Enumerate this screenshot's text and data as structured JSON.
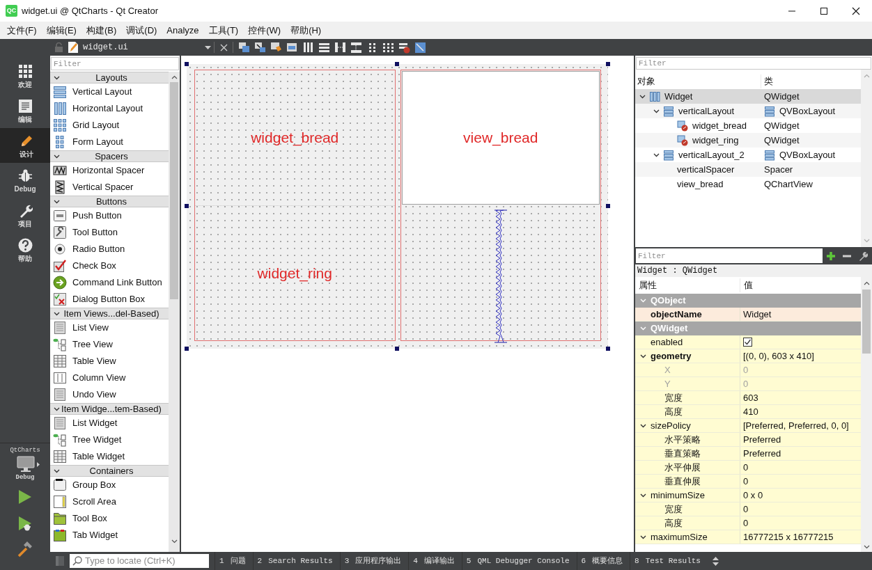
{
  "window": {
    "logo": "QC",
    "title": "widget.ui @ QtCharts - Qt Creator"
  },
  "menu": [
    "文件(F)",
    "编辑(E)",
    "构建(B)",
    "调试(D)",
    "Analyze",
    "工具(T)",
    "控件(W)",
    "帮助(H)"
  ],
  "mode_bar": {
    "items": [
      {
        "label": "欢迎",
        "selected": false
      },
      {
        "label": "编辑",
        "selected": false
      },
      {
        "label": "设计",
        "selected": true
      },
      {
        "label": "Debug",
        "selected": false
      },
      {
        "label": "项目",
        "selected": false
      },
      {
        "label": "帮助",
        "selected": false
      }
    ],
    "kit": {
      "project": "QtCharts",
      "config": "Debug"
    }
  },
  "toolbar": {
    "file": "widget.ui"
  },
  "widget_box": {
    "filter_placeholder": "Filter",
    "categories": [
      {
        "title": "Layouts",
        "expanded": true,
        "items": [
          "Vertical Layout",
          "Horizontal Layout",
          "Grid Layout",
          "Form Layout"
        ]
      },
      {
        "title": "Spacers",
        "expanded": true,
        "items": [
          "Horizontal Spacer",
          "Vertical Spacer"
        ]
      },
      {
        "title": "Buttons",
        "expanded": true,
        "items": [
          "Push Button",
          "Tool Button",
          "Radio Button",
          "Check Box",
          "Command Link Button",
          "Dialog Button Box"
        ]
      },
      {
        "title": "Item Views...del-Based)",
        "expanded": true,
        "items": [
          "List View",
          "Tree View",
          "Table View",
          "Column View",
          "Undo View"
        ]
      },
      {
        "title": "Item Widge...tem-Based)",
        "expanded": true,
        "items": [
          "List Widget",
          "Tree Widget",
          "Table Widget"
        ]
      },
      {
        "title": "Containers",
        "expanded": true,
        "items": [
          "Group Box",
          "Scroll Area",
          "Tool Box",
          "Tab Widget"
        ]
      }
    ]
  },
  "form": {
    "selected": true,
    "layouts": [
      {
        "items": [
          {
            "kind": "widget",
            "name": "widget_bread"
          },
          {
            "kind": "widget",
            "name": "widget_ring"
          }
        ]
      },
      {
        "items": [
          {
            "kind": "chartview",
            "name": "view_bread"
          },
          {
            "kind": "spacer"
          }
        ]
      }
    ]
  },
  "object_inspector": {
    "filter_placeholder": "Filter",
    "columns": [
      "对象",
      "类"
    ],
    "tree": [
      {
        "name": "Widget",
        "class": "QWidget",
        "kind": "hbox",
        "selected": true,
        "expanded": true,
        "children": [
          {
            "name": "verticalLayout",
            "class": "QVBoxLayout",
            "kind": "vbox",
            "selected": false,
            "expanded": true,
            "children": [
              {
                "name": "widget_bread",
                "class": "QWidget",
                "kind": "widget",
                "selected": false
              },
              {
                "name": "widget_ring",
                "class": "QWidget",
                "kind": "widget",
                "selected": false
              }
            ]
          },
          {
            "name": "verticalLayout_2",
            "class": "QVBoxLayout",
            "kind": "vbox",
            "selected": false,
            "expanded": true,
            "children": [
              {
                "name": "verticalSpacer",
                "class": "Spacer",
                "kind": "plain",
                "selected": false
              },
              {
                "name": "view_bread",
                "class": "QChartView",
                "kind": "plain",
                "selected": false
              }
            ]
          }
        ]
      }
    ]
  },
  "property_editor": {
    "filter_placeholder": "Filter",
    "context": "Widget : QWidget",
    "columns": [
      "属性",
      "值"
    ],
    "groups": [
      {
        "name": "QObject",
        "expanded": true,
        "color": "#fcebdc",
        "properties": [
          {
            "name": "objectName",
            "value": "Widget",
            "changed": true
          }
        ]
      },
      {
        "name": "QWidget",
        "expanded": true,
        "color": "#fffcd2",
        "properties": [
          {
            "name": "enabled",
            "kind": "checkbox",
            "checked": true,
            "changed": false
          },
          {
            "name": "geometry",
            "value": "[(0, 0), 603 x 410]",
            "changed": true,
            "expanded": true,
            "children": [
              {
                "name": "X",
                "value": "0",
                "disabled": true
              },
              {
                "name": "Y",
                "value": "0",
                "disabled": true
              },
              {
                "name": "宽度",
                "value": "603",
                "disabled": false
              },
              {
                "name": "高度",
                "value": "410",
                "disabled": false
              }
            ]
          },
          {
            "name": "sizePolicy",
            "value": "[Preferred, Preferred, 0, 0]",
            "changed": false,
            "expanded": true,
            "children": [
              {
                "name": "水平策略",
                "value": "Preferred"
              },
              {
                "name": "垂直策略",
                "value": "Preferred"
              },
              {
                "name": "水平伸展",
                "value": "0"
              },
              {
                "name": "垂直伸展",
                "value": "0"
              }
            ]
          },
          {
            "name": "minimumSize",
            "value": "0 x 0",
            "changed": false,
            "expanded": true,
            "children": [
              {
                "name": "宽度",
                "value": "0"
              },
              {
                "name": "高度",
                "value": "0"
              }
            ]
          },
          {
            "name": "maximumSize",
            "value": "16777215 x 16777215",
            "changed": false,
            "expanded": true
          }
        ]
      }
    ]
  },
  "output_bar": {
    "locate_placeholder": "Type to locate (Ctrl+K)",
    "tabs": [
      {
        "number": "1",
        "label": "问题"
      },
      {
        "number": "2",
        "label": "Search Results"
      },
      {
        "number": "3",
        "label": "应用程序输出"
      },
      {
        "number": "4",
        "label": "编译输出"
      },
      {
        "number": "5",
        "label": "QML Debugger Console"
      },
      {
        "number": "6",
        "label": "概要信息"
      },
      {
        "number": "8",
        "label": "Test Results"
      }
    ]
  }
}
